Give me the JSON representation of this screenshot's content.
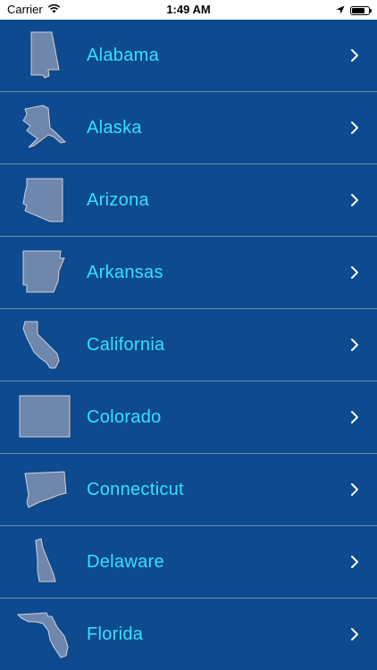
{
  "status_bar": {
    "carrier": "Carrier",
    "time": "1:49 AM",
    "battery_level": 0.75
  },
  "states": [
    {
      "label": "Alabama",
      "icon": "alabama-outline-icon"
    },
    {
      "label": "Alaska",
      "icon": "alaska-outline-icon"
    },
    {
      "label": "Arizona",
      "icon": "arizona-outline-icon"
    },
    {
      "label": "Arkansas",
      "icon": "arkansas-outline-icon"
    },
    {
      "label": "California",
      "icon": "california-outline-icon"
    },
    {
      "label": "Colorado",
      "icon": "colorado-outline-icon"
    },
    {
      "label": "Connecticut",
      "icon": "connecticut-outline-icon"
    },
    {
      "label": "Delaware",
      "icon": "delaware-outline-icon"
    },
    {
      "label": "Florida",
      "icon": "florida-outline-icon"
    }
  ],
  "colors": {
    "background": "#0d4a8f",
    "label": "#35e0ff",
    "separator": "#6f8fb6",
    "shape_fill": "#6f86ad"
  }
}
